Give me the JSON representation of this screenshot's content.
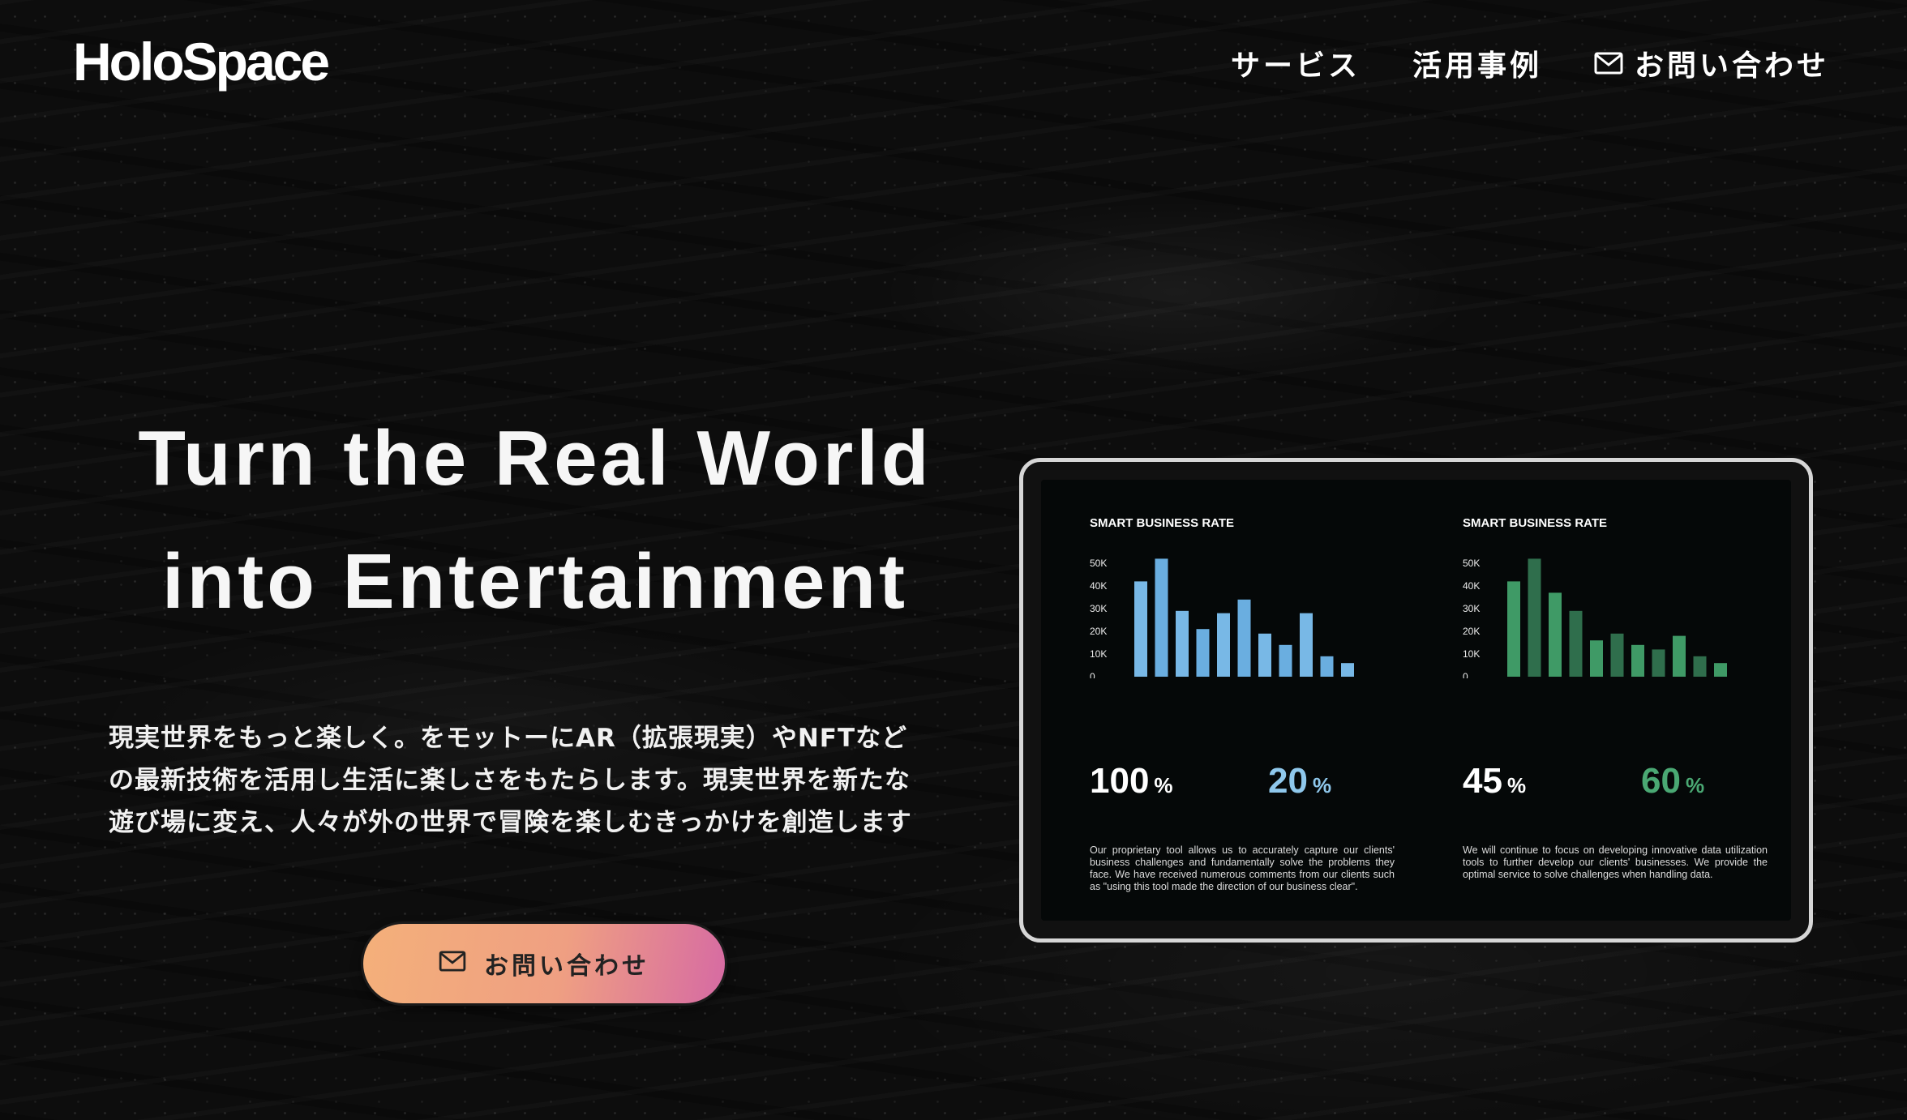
{
  "brand": {
    "logo_text": "HoloSpace"
  },
  "nav": {
    "items": [
      {
        "label": "サービス"
      },
      {
        "label": "活用事例"
      },
      {
        "label": "お問い合わせ",
        "icon": "mail-icon"
      }
    ]
  },
  "hero": {
    "title_line1": "Turn the Real World",
    "title_line2": "into Entertainment",
    "desc_line1": "現実世界をもっと楽しく。をモットーにAR（拡張現実）やNFTなど",
    "desc_line2": "の最新技術を活用し生活に楽しさをもたらします。現実世界を新たな",
    "desc_line3": "遊び場に変え、人々が外の世界で冒険を楽しむきっかけを創造します",
    "cta_label": "お問い合わせ",
    "cta_icon": "mail-icon"
  },
  "colors": {
    "accent_blue": "#6fb1e0",
    "accent_green": "#3e9a66",
    "cta_gradient_start": "#f4b07a",
    "cta_gradient_end": "#d66aa3"
  },
  "panels": [
    {
      "title": "SMART BUSINESS RATE",
      "stat1_value": "100",
      "stat1_unit": "%",
      "stat2_value": "20",
      "stat2_unit": "%",
      "stat2_color": "#8fc8ec",
      "description": "Our proprietary tool allows us to accurately capture our clients' business challenges and fundamentally solve the problems they face. We have received numerous comments from our clients such as \"using this tool made the direction of our business clear\"."
    },
    {
      "title": "SMART BUSINESS RATE",
      "stat1_value": "45",
      "stat1_unit": "%",
      "stat2_value": "60",
      "stat2_unit": "%",
      "stat2_color": "#4aa873",
      "description": "We will continue to focus on developing innovative data utilization tools to further develop our clients' businesses. We provide the optimal service to solve challenges when handling data."
    }
  ],
  "chart_data": [
    {
      "type": "bar",
      "title": "SMART BUSINESS RATE",
      "y_ticks": [
        "50K",
        "40K",
        "30K",
        "20K",
        "10K",
        "0"
      ],
      "ylim": [
        0,
        50000
      ],
      "values": [
        42000,
        52000,
        29000,
        21000,
        28000,
        34000,
        19000,
        14000,
        28000,
        9000,
        6000
      ],
      "colors": [
        "#78b8e6",
        "#6aaee0"
      ]
    },
    {
      "type": "bar",
      "title": "SMART BUSINESS RATE",
      "y_ticks": [
        "50K",
        "40K",
        "30K",
        "20K",
        "10K",
        "0"
      ],
      "ylim": [
        0,
        50000
      ],
      "values": [
        42000,
        52000,
        37000,
        29000,
        16000,
        19000,
        14000,
        12000,
        18000,
        9000,
        6000
      ],
      "colors": [
        "#3f9a66",
        "#2f6e4c"
      ]
    }
  ]
}
